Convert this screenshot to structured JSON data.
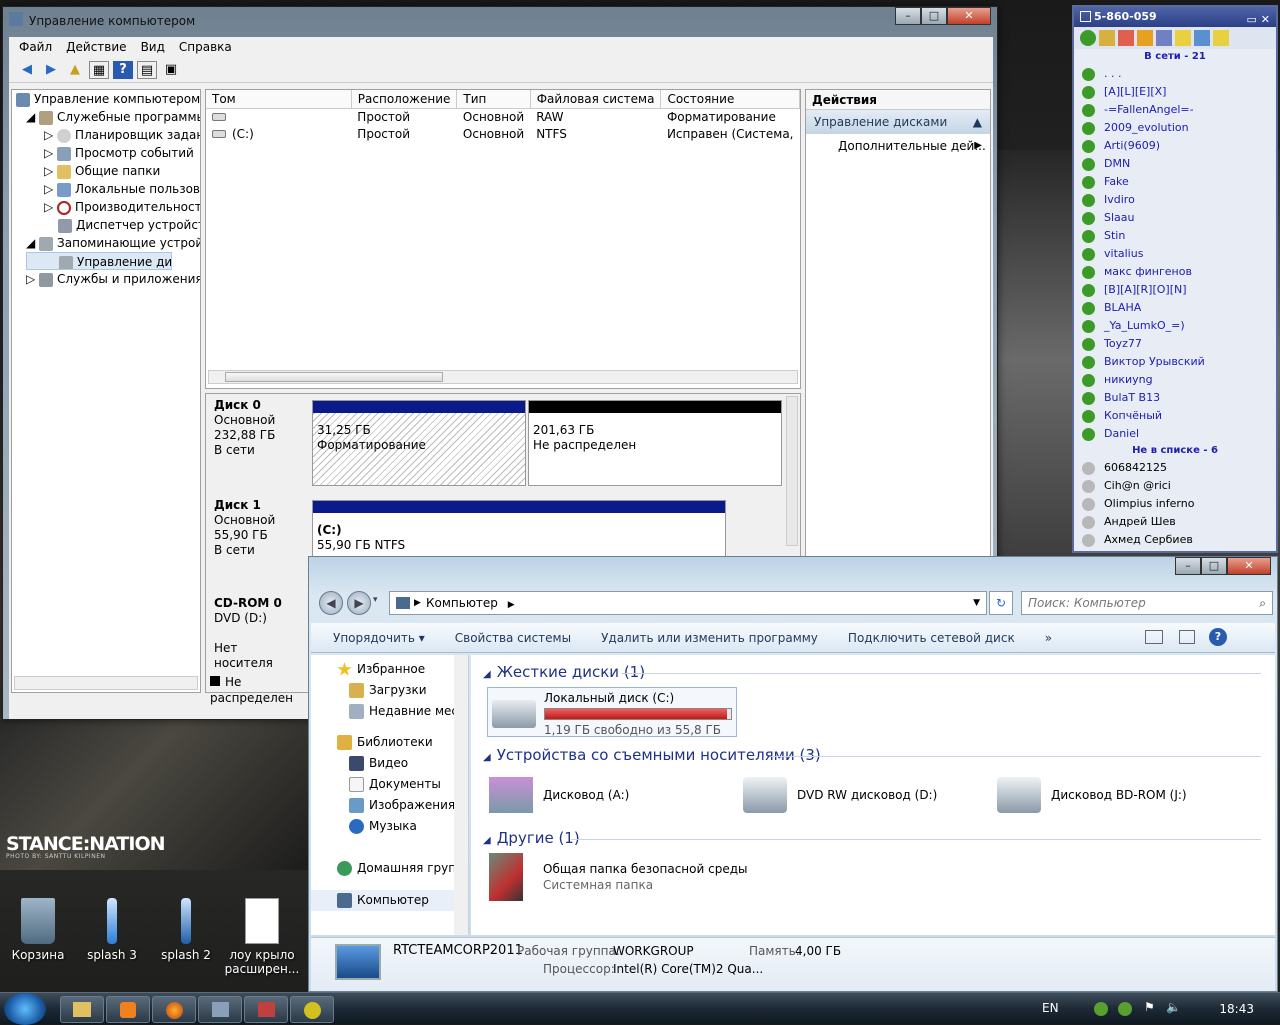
{
  "desktop": {
    "wallpaper_brand": "STANCE:NATION",
    "wallpaper_credit": "PHOTO BY: SANTTU KILPINEN",
    "icons": [
      {
        "label": "Корзина"
      },
      {
        "label": "splash 3"
      },
      {
        "label": "splash 2"
      },
      {
        "label": "лоу крыло расширен..."
      }
    ]
  },
  "compmgmt": {
    "title": "Управление компьютером",
    "menu": [
      "Файл",
      "Действие",
      "Вид",
      "Справка"
    ],
    "tree": [
      "Управление компьютером (л",
      "Служебные программы",
      "Планировщик заданий",
      "Просмотр событий",
      "Общие папки",
      "Локальные пользовате",
      "Производительность",
      "Диспетчер устройств",
      "Запоминающие устройст",
      "Управление дисками",
      "Службы и приложения"
    ],
    "volume_columns": [
      "Том",
      "Расположение",
      "Тип",
      "Файловая система",
      "Состояние"
    ],
    "volumes": [
      [
        "",
        "Простой",
        "Основной",
        "RAW",
        "Форматирование"
      ],
      [
        "(C:)",
        "Простой",
        "Основной",
        "NTFS",
        "Исправен (Система,"
      ]
    ],
    "disks": [
      {
        "name": "Диск 0",
        "type": "Основной",
        "size": "232,88 ГБ",
        "status": "В сети",
        "parts": [
          {
            "size": "31,25 ГБ",
            "state": "Форматирование"
          },
          {
            "size": "201,63 ГБ",
            "state": "Не распределен"
          }
        ]
      },
      {
        "name": "Диск 1",
        "type": "Основной",
        "size": "55,90 ГБ",
        "status": "В сети",
        "parts": [
          {
            "label": "(C:)",
            "size": "55,90 ГБ NTFS"
          }
        ]
      },
      {
        "name": "CD-ROM 0",
        "type": "DVD (D:)",
        "status": "Нет носителя"
      }
    ],
    "legend_unallocated": "Не распределен",
    "actions_title": "Действия",
    "actions_group": "Управление дисками",
    "actions_more": "Дополнительные дей..."
  },
  "icq": {
    "title": "5-860-059",
    "online_header": "В сети - 21",
    "online": [
      ". . .",
      "[A][L][E][X]",
      "-=FallenAngel=-",
      "2009_evolution",
      "Arti(9609)",
      "DMN",
      "Fake",
      "Ivdiro",
      "Slaau",
      "Stin",
      "vitalius",
      "макс фингенов",
      "[B][A][R][O][N]",
      "BLAHA",
      "_Ya_LumkO_=)",
      "Toyz77",
      "Виктор Урывский",
      "никиyng",
      "BulaT B13",
      "Копчёный",
      "Daniel"
    ],
    "offline_header": "Не в списке - 6",
    "offline": [
      "606842125",
      "Cih@n @rici",
      "Olimpius inferno",
      "Андрей Шев",
      "Ахмед Сербиев"
    ]
  },
  "explorer": {
    "breadcrumb": "Компьютер",
    "search_placeholder": "Поиск: Компьютер",
    "commands": [
      "Упорядочить ▾",
      "Свойства системы",
      "Удалить или изменить программу",
      "Подключить сетевой диск",
      "»"
    ],
    "nav": {
      "favorites": "Избранное",
      "fav_items": [
        "Загрузки",
        "Недавние места"
      ],
      "libraries": "Библиотеки",
      "lib_items": [
        "Видео",
        "Документы",
        "Изображения",
        "Музыка"
      ],
      "homegroup": "Домашняя группа",
      "computer": "Компьютер"
    },
    "groups": {
      "hdd": "Жесткие диски (1)",
      "removable": "Устройства со съемными носителями (3)",
      "other": "Другие (1)"
    },
    "local_disk": {
      "name": "Локальный диск (C:)",
      "free": "1,19 ГБ свободно из 55,8 ГБ",
      "used_fraction": 0.98
    },
    "removable": [
      "Дисковод (A:)",
      "DVD RW дисковод (D:)",
      "Дисковод BD-ROM (J:)"
    ],
    "other_item": {
      "name": "Общая папка безопасной среды",
      "sub": "Системная папка"
    },
    "details": {
      "computer_name": "RTCTEAMCORP2011",
      "workgroup_label": "Рабочая группа:",
      "workgroup": "WORKGROUP",
      "memory_label": "Память:",
      "memory": "4,00 ГБ",
      "cpu_label": "Процессор:",
      "cpu": "Intel(R) Core(TM)2 Qua..."
    }
  },
  "taskbar": {
    "lang": "EN",
    "time": "18:43"
  }
}
